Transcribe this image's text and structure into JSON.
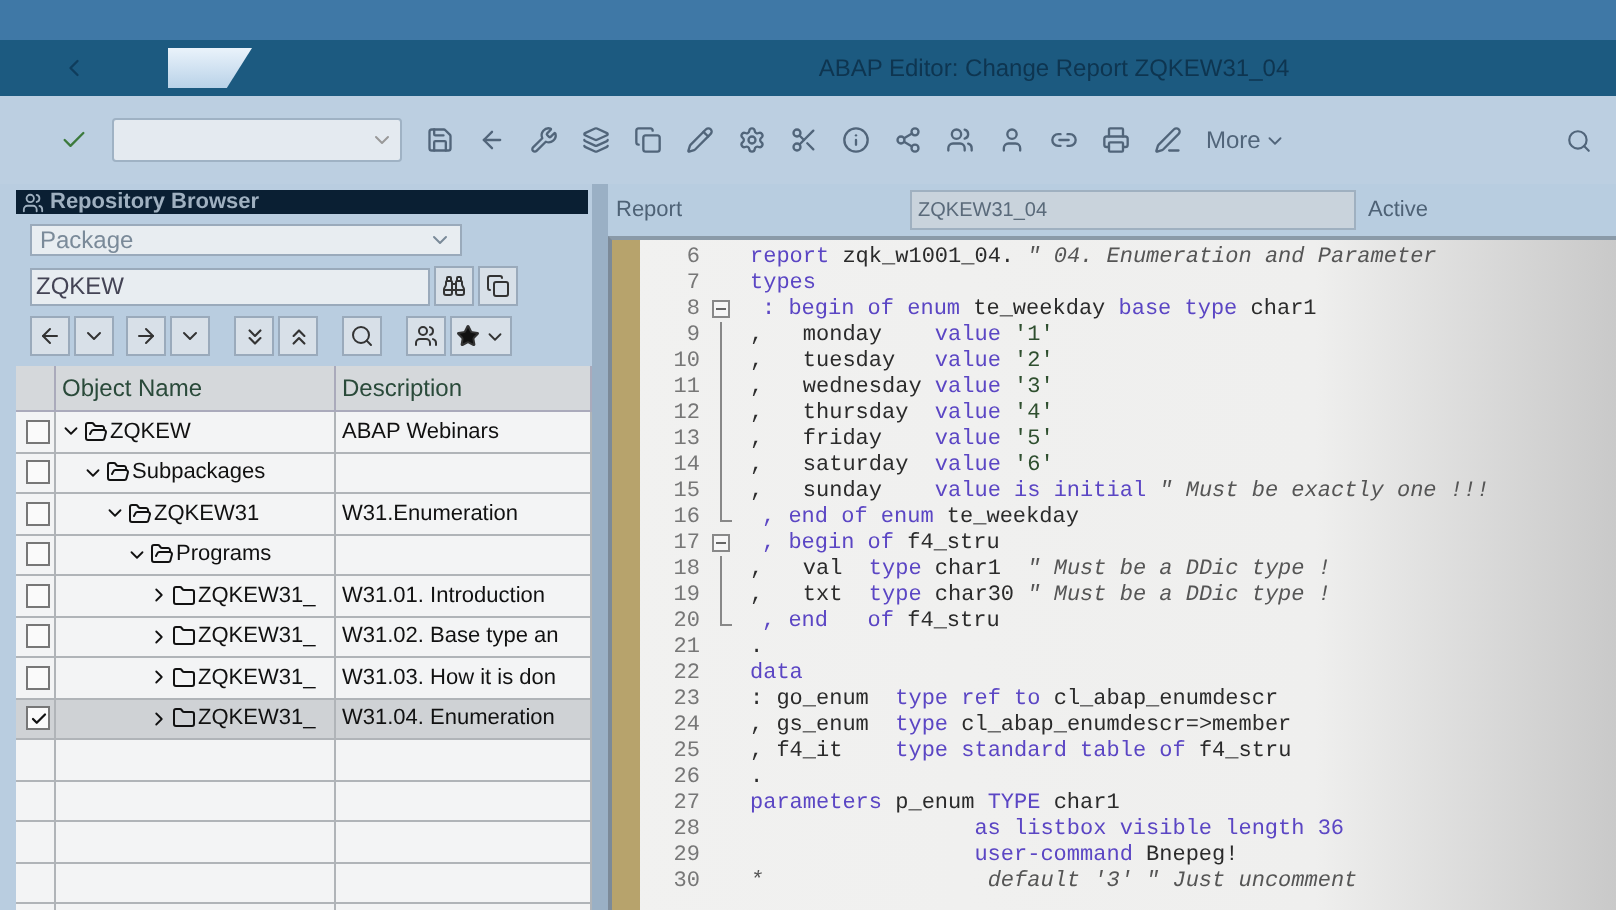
{
  "window": {
    "title": "ABAP Editor: Change Report ZQKEW31_04"
  },
  "toolbar": {
    "more_label": "More"
  },
  "repository_browser": {
    "title": "Repository Browser",
    "object_type": "Package",
    "object_name": "ZQKEW",
    "columns": [
      "Object Name",
      "Description"
    ],
    "tree": [
      {
        "name": "ZQKEW",
        "description": "ABAP Webinars",
        "kind": "package",
        "checked": false,
        "expanded": true,
        "children": [
          {
            "name": "Subpackages",
            "kind": "package",
            "checked": false,
            "expanded": true,
            "children": [
              {
                "name": "ZQKEW31",
                "description": "W31.Enumeration",
                "kind": "package",
                "checked": false,
                "expanded": true,
                "children": [
                  {
                    "name": "Programs",
                    "kind": "package",
                    "checked": false,
                    "expanded": true,
                    "children": [
                      {
                        "name": "ZQKEW31_",
                        "description": "W31.01. Introduction",
                        "kind": "folder",
                        "checked": false,
                        "expanded": false
                      },
                      {
                        "name": "ZQKEW31_",
                        "description": "W31.02. Base type an",
                        "kind": "folder",
                        "checked": false,
                        "expanded": false
                      },
                      {
                        "name": "ZQKEW31_",
                        "description": "W31.03. How it is don",
                        "kind": "folder",
                        "checked": false,
                        "expanded": false
                      },
                      {
                        "name": "ZQKEW31_",
                        "description": "W31.04. Enumeration",
                        "kind": "folder",
                        "checked": true,
                        "expanded": false
                      }
                    ]
                  }
                ]
              }
            ]
          }
        ]
      }
    ]
  },
  "editor": {
    "object_label": "Report",
    "object_name": "ZQKEW31_04",
    "status": "Active",
    "lines": [
      {
        "num": "6",
        "kind": "code",
        "tokens": [
          {
            "kind": "k",
            "t": "report"
          },
          {
            "kind": "n",
            "t": " zqk_w1001_04. "
          },
          {
            "kind": "c",
            "t": "\" 04. Enumeration and Parameter"
          }
        ]
      },
      {
        "num": "7",
        "kind": "code",
        "tokens": [
          {
            "kind": "k",
            "t": "types"
          }
        ]
      },
      {
        "num": "8",
        "kind": "fold_start",
        "tokens": [
          {
            "kind": "k",
            "t": ": begin of enum"
          },
          {
            "kind": "n",
            "t": " te_weekday "
          },
          {
            "kind": "k",
            "t": "base type"
          },
          {
            "kind": "n",
            "t": " char1"
          }
        ]
      },
      {
        "num": "9",
        "kind": "fold_body",
        "tokens": [
          {
            "kind": "n",
            "t": ",   monday    "
          },
          {
            "kind": "k",
            "t": "value"
          },
          {
            "kind": "s",
            "t": " '1'"
          }
        ]
      },
      {
        "num": "10",
        "kind": "fold_body",
        "tokens": [
          {
            "kind": "n",
            "t": ",   tuesday   "
          },
          {
            "kind": "k",
            "t": "value"
          },
          {
            "kind": "s",
            "t": " '2'"
          }
        ]
      },
      {
        "num": "11",
        "kind": "fold_body",
        "tokens": [
          {
            "kind": "n",
            "t": ",   wednesday "
          },
          {
            "kind": "k",
            "t": "value"
          },
          {
            "kind": "s",
            "t": " '3'"
          }
        ]
      },
      {
        "num": "12",
        "kind": "fold_body",
        "tokens": [
          {
            "kind": "n",
            "t": ",   thursday  "
          },
          {
            "kind": "k",
            "t": "value"
          },
          {
            "kind": "s",
            "t": " '4'"
          }
        ]
      },
      {
        "num": "13",
        "kind": "fold_body",
        "tokens": [
          {
            "kind": "n",
            "t": ",   friday    "
          },
          {
            "kind": "k",
            "t": "value"
          },
          {
            "kind": "s",
            "t": " '5'"
          }
        ]
      },
      {
        "num": "14",
        "kind": "fold_body",
        "tokens": [
          {
            "kind": "n",
            "t": ",   saturday  "
          },
          {
            "kind": "k",
            "t": "value"
          },
          {
            "kind": "s",
            "t": " '6'"
          }
        ]
      },
      {
        "num": "15",
        "kind": "fold_body",
        "tokens": [
          {
            "kind": "n",
            "t": ",   sunday    "
          },
          {
            "kind": "k",
            "t": "value is initial"
          },
          {
            "kind": "c",
            "t": " \" Must be exactly one !!!"
          }
        ]
      },
      {
        "num": "16",
        "kind": "fold_end",
        "tokens": [
          {
            "kind": "k",
            "t": ", end of enum"
          },
          {
            "kind": "n",
            "t": " te_weekday"
          }
        ]
      },
      {
        "num": "17",
        "kind": "fold_start",
        "tokens": [
          {
            "kind": "k",
            "t": ", begin of"
          },
          {
            "kind": "n",
            "t": " f4_stru"
          }
        ]
      },
      {
        "num": "18",
        "kind": "fold_body",
        "tokens": [
          {
            "kind": "n",
            "t": ",   val  "
          },
          {
            "kind": "k",
            "t": "type"
          },
          {
            "kind": "n",
            "t": " char1  "
          },
          {
            "kind": "c",
            "t": "\" Must be a DDic type !"
          }
        ]
      },
      {
        "num": "19",
        "kind": "fold_body",
        "tokens": [
          {
            "kind": "n",
            "t": ",   txt  "
          },
          {
            "kind": "k",
            "t": "type"
          },
          {
            "kind": "n",
            "t": " char30 "
          },
          {
            "kind": "c",
            "t": "\" Must be a DDic type !"
          }
        ]
      },
      {
        "num": "20",
        "kind": "fold_end",
        "tokens": [
          {
            "kind": "k",
            "t": ", end   of"
          },
          {
            "kind": "n",
            "t": " f4_stru"
          }
        ]
      },
      {
        "num": "21",
        "kind": "code",
        "tokens": [
          {
            "kind": "n",
            "t": "."
          }
        ]
      },
      {
        "num": "22",
        "kind": "code",
        "tokens": [
          {
            "kind": "k",
            "t": "data"
          }
        ]
      },
      {
        "num": "23",
        "kind": "code",
        "tokens": [
          {
            "kind": "n",
            "t": ": go_enum  "
          },
          {
            "kind": "k",
            "t": "type ref to"
          },
          {
            "kind": "n",
            "t": " cl_abap_enumdescr"
          }
        ]
      },
      {
        "num": "24",
        "kind": "code",
        "tokens": [
          {
            "kind": "n",
            "t": ", gs_enum  "
          },
          {
            "kind": "k",
            "t": "type"
          },
          {
            "kind": "n",
            "t": " cl_abap_enumdescr=>member"
          }
        ]
      },
      {
        "num": "25",
        "kind": "code",
        "tokens": [
          {
            "kind": "n",
            "t": ", f4_it    "
          },
          {
            "kind": "k",
            "t": "type standard table of"
          },
          {
            "kind": "n",
            "t": " f4_stru"
          }
        ]
      },
      {
        "num": "26",
        "kind": "code",
        "tokens": [
          {
            "kind": "n",
            "t": "."
          }
        ]
      },
      {
        "num": "27",
        "kind": "code",
        "tokens": [
          {
            "kind": "k",
            "t": "parameters"
          },
          {
            "kind": "n",
            "t": " p_enum "
          },
          {
            "kind": "k",
            "t": "TYPE"
          },
          {
            "kind": "n",
            "t": " char1"
          }
        ]
      },
      {
        "num": "28",
        "kind": "continuation",
        "tokens": [
          {
            "kind": "k",
            "t": "as listbox visible length 36"
          }
        ]
      },
      {
        "num": "29",
        "kind": "continuation",
        "tokens": [
          {
            "kind": "k",
            "t": "user-command"
          },
          {
            "kind": "n",
            "t": " Bnepeg!"
          }
        ]
      },
      {
        "num": "30",
        "kind": "code",
        "tokens": [
          {
            "kind": "c",
            "t": "*                 default '3' \" Just uncomment"
          }
        ]
      }
    ]
  }
}
